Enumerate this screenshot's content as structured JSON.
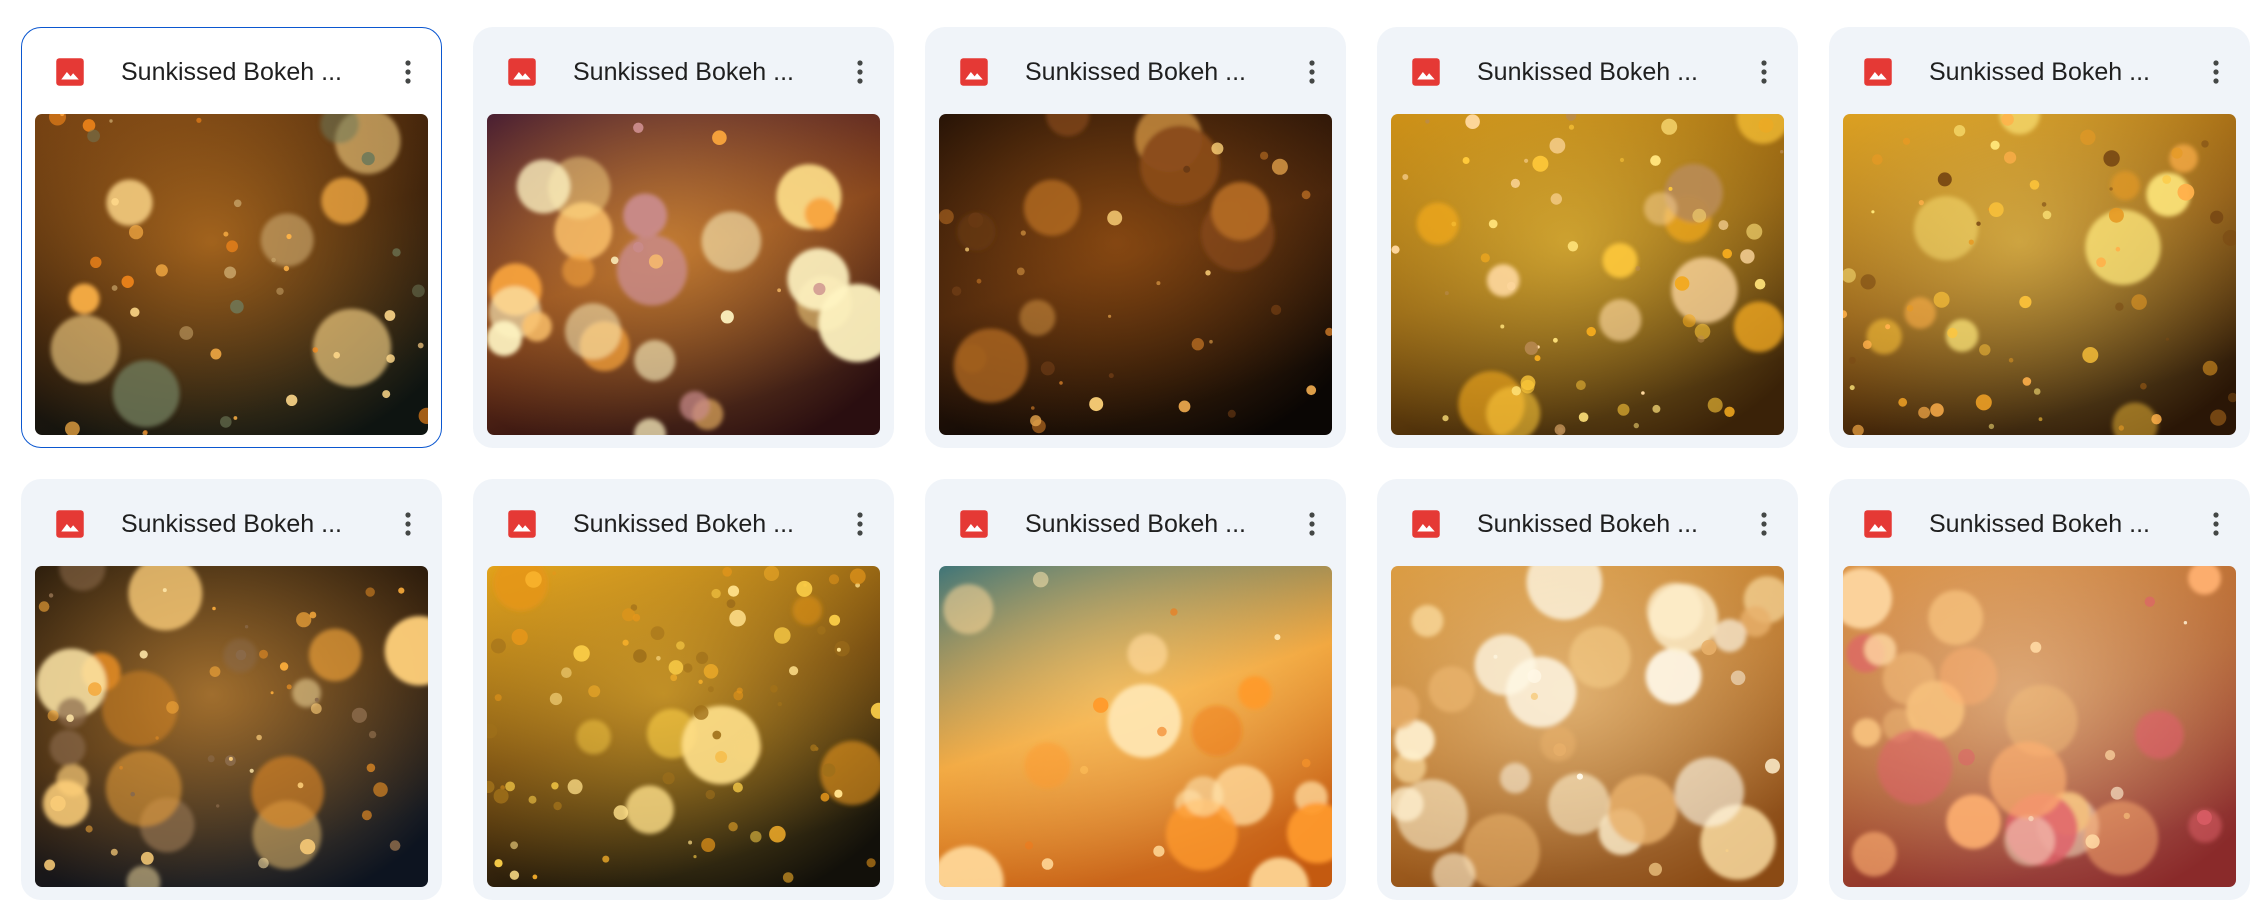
{
  "files": [
    {
      "title": "Sunkissed Bokeh ...",
      "selected": true,
      "icon": "image-file-icon",
      "thumb": {
        "bg": [
          "#6a3a10",
          "#2a1608",
          "#0e1411"
        ],
        "glow": "#ff9f2e",
        "seed": 11,
        "big": 9,
        "small": 40,
        "palette": [
          "#ffd98a",
          "#ffb347",
          "#ff8c1a",
          "#c9a66b",
          "#6f7a5a"
        ]
      }
    },
    {
      "title": "Sunkissed Bokeh ...",
      "selected": false,
      "icon": "image-file-icon",
      "thumb": {
        "bg": [
          "#3a1230",
          "#7a3a18",
          "#2a0e10"
        ],
        "glow": "#ffb247",
        "seed": 23,
        "big": 22,
        "small": 8,
        "palette": [
          "#fff4c2",
          "#ffe08a",
          "#ffc46b",
          "#f7a33c",
          "#c98a8a"
        ]
      }
    },
    {
      "title": "Sunkissed Bokeh ...",
      "selected": false,
      "icon": "image-file-icon",
      "thumb": {
        "bg": [
          "#1a0c05",
          "#3a1d0a",
          "#0a0604"
        ],
        "glow": "#c46a18",
        "seed": 37,
        "big": 10,
        "small": 30,
        "palette": [
          "#e3a24a",
          "#b36a22",
          "#8a4a18",
          "#ffd47a",
          "#6a3a14"
        ]
      }
    },
    {
      "title": "Sunkissed Bokeh ...",
      "selected": false,
      "icon": "image-file-icon",
      "thumb": {
        "bg": [
          "#c98a12",
          "#8a5a10",
          "#3a2208"
        ],
        "glow": "#ffd84a",
        "seed": 51,
        "big": 12,
        "small": 55,
        "palette": [
          "#ffe27a",
          "#ffc93a",
          "#f2a91e",
          "#ffd9a0",
          "#b88a52"
        ]
      }
    },
    {
      "title": "Sunkissed Bokeh ...",
      "selected": false,
      "icon": "image-file-icon",
      "thumb": {
        "bg": [
          "#d99a1a",
          "#8a5412",
          "#2a1606"
        ],
        "glow": "#ffe066",
        "seed": 67,
        "big": 10,
        "small": 60,
        "palette": [
          "#ffe77a",
          "#ffc53a",
          "#e69a24",
          "#ffb04a",
          "#7a4a14"
        ]
      }
    },
    {
      "title": "Sunkissed Bokeh ...",
      "selected": false,
      "icon": "image-file-icon",
      "thumb": {
        "bg": [
          "#1c1208",
          "#2e1c0c",
          "#0d1420"
        ],
        "glow": "#ffb24a",
        "seed": 79,
        "big": 18,
        "small": 45,
        "palette": [
          "#ffd07a",
          "#f5a83a",
          "#e08a24",
          "#ffe7a8",
          "#8a6a4a"
        ]
      }
    },
    {
      "title": "Sunkissed Bokeh ...",
      "selected": false,
      "icon": "image-file-icon",
      "thumb": {
        "bg": [
          "#e0a01a",
          "#6a420e",
          "#12100a"
        ],
        "glow": "#ffc83a",
        "seed": 91,
        "big": 8,
        "small": 80,
        "palette": [
          "#ffd24a",
          "#f7b02a",
          "#e6961a",
          "#ffe08a",
          "#a0701a"
        ]
      }
    },
    {
      "title": "Sunkissed Bokeh ...",
      "selected": false,
      "icon": "image-file-icon",
      "thumb": {
        "bg": [
          "#2f6d78",
          "#f0a33a",
          "#c45a10"
        ],
        "glow": "#ffd27a",
        "seed": 103,
        "big": 14,
        "small": 10,
        "palette": [
          "#ffe6b0",
          "#ffc05a",
          "#ff9a2a",
          "#f07a1a",
          "#ffd898"
        ]
      }
    },
    {
      "title": "Sunkissed Bokeh ...",
      "selected": false,
      "icon": "image-file-icon",
      "thumb": {
        "bg": [
          "#d8963a",
          "#b7732a",
          "#8a4a14"
        ],
        "glow": "#ffe0a8",
        "seed": 117,
        "big": 26,
        "small": 10,
        "palette": [
          "#fff1cf",
          "#ffe2a6",
          "#f7cf8a",
          "#fff8e6",
          "#e8b06a"
        ]
      }
    },
    {
      "title": "Sunkissed Bokeh ...",
      "selected": false,
      "icon": "image-file-icon",
      "thumb": {
        "bg": [
          "#d68a3a",
          "#b06030",
          "#8a2a2a"
        ],
        "glow": "#ffe0b0",
        "seed": 131,
        "big": 22,
        "small": 10,
        "palette": [
          "#fff0d2",
          "#ffd9a4",
          "#f6c07c",
          "#e0606a",
          "#ffb070"
        ]
      }
    }
  ],
  "colors": {
    "card_bg": "#f0f4f9",
    "selected_border": "#0b57d0",
    "image_icon": "#e53935",
    "title_text": "#1f1f1f",
    "more_icon": "#444746"
  }
}
